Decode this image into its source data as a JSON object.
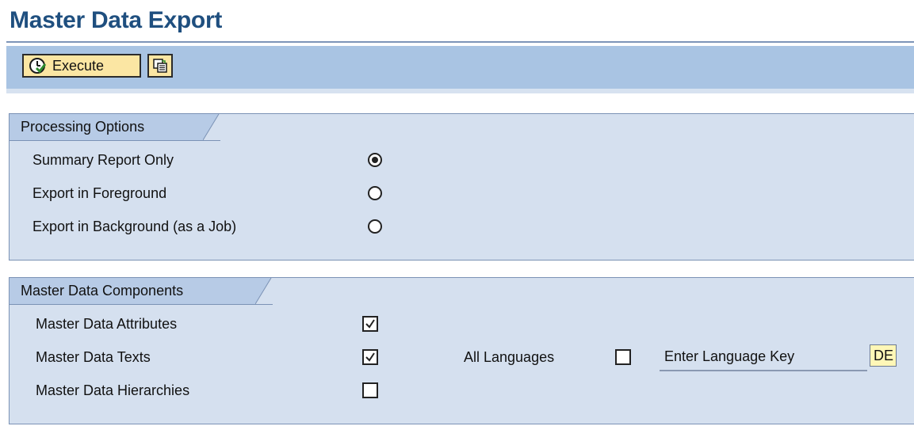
{
  "page_title": "Master Data Export",
  "toolbar": {
    "execute_label": "Execute",
    "execute_icon": "execute-clock-icon",
    "variant_icon": "get-variant-icon"
  },
  "processing_options": {
    "title": "Processing Options",
    "options": [
      {
        "label": "Summary Report Only",
        "selected": true
      },
      {
        "label": "Export in Foreground",
        "selected": false
      },
      {
        "label": "Export in Background (as a Job)",
        "selected": false
      }
    ]
  },
  "master_data_components": {
    "title": "Master Data Components",
    "items": [
      {
        "label": "Master Data Attributes",
        "checked": true
      },
      {
        "label": "Master Data Texts",
        "checked": true
      },
      {
        "label": "Master Data Hierarchies",
        "checked": false
      }
    ],
    "all_languages_label": "All Languages",
    "all_languages_checked": false,
    "language_key_label": "Enter Language Key",
    "language_key_value": "DE"
  },
  "colors": {
    "title": "#1f4f7f",
    "toolbar_bg": "#a9c4e3",
    "button_bg": "#fbe6a3",
    "group_bg": "#d5e0ef",
    "input_bg": "#fff7b7"
  }
}
